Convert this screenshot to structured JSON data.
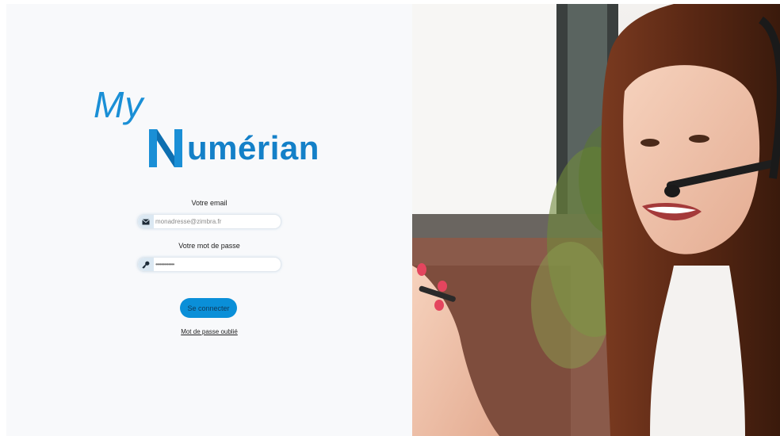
{
  "logo": {
    "prefix": "My",
    "initial": "N",
    "rest": "umérian",
    "colors": {
      "light": "#1a8fd6",
      "dark": "#1480c8"
    }
  },
  "form": {
    "email_label": "Votre email",
    "email_placeholder": "monadresse@zimbra.fr",
    "email_icon": "envelope-icon",
    "password_label": "Votre mot de passe",
    "password_value": "•••••••••••••",
    "password_icon": "key-icon",
    "submit_label": "Se connecter",
    "forgot_label": "Mot de passe oublié"
  },
  "colors": {
    "accent": "#0a8fd8",
    "background": "#f8f9fb"
  }
}
